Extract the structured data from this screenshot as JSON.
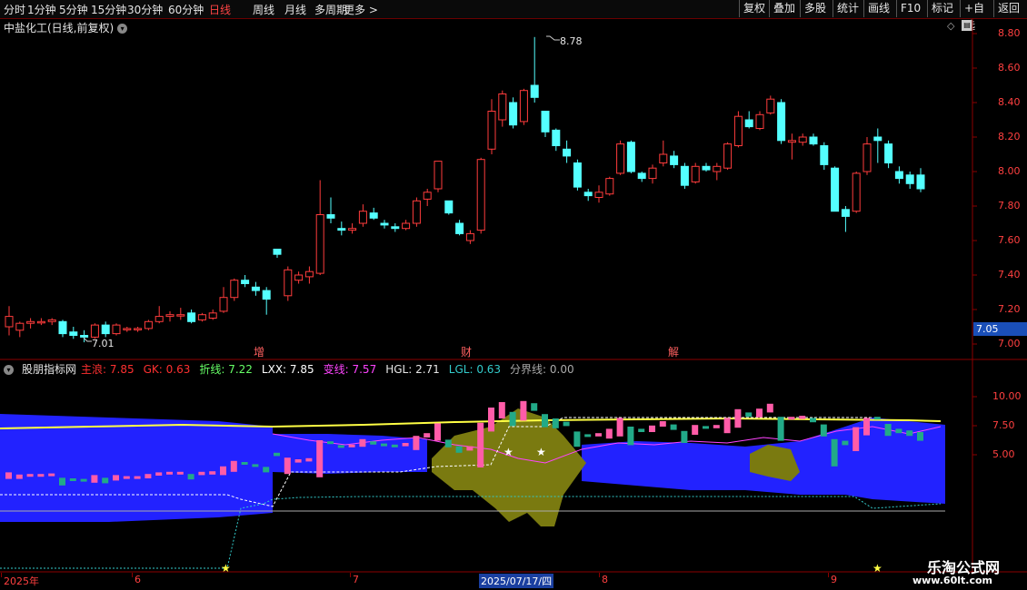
{
  "toolbar": {
    "periods": [
      "分时",
      "1分钟",
      "5分钟",
      "15分钟",
      "30分钟",
      "60分钟",
      "日线",
      "周线",
      "月线",
      "多周期",
      "更多 >"
    ],
    "active_period": "日线",
    "right_buttons": [
      "复权",
      "叠加",
      "多股",
      "统计",
      "画线",
      "F10",
      "标记",
      "+自选",
      "返回"
    ]
  },
  "main_chart": {
    "title": "中盐化工(日线,前复权)",
    "y_ticks": [
      "8.80",
      "8.60",
      "8.40",
      "8.20",
      "8.00",
      "7.80",
      "7.60",
      "7.40",
      "7.20",
      "7.00"
    ],
    "current_price": "7.05",
    "high_label": "8.78",
    "low_label": "7.01",
    "event_markers": [
      "增",
      "财",
      "解"
    ]
  },
  "indicator": {
    "name": "股朋指标网",
    "values": [
      {
        "label": "主浪",
        "value": "7.85",
        "color": "#ff3030"
      },
      {
        "label": "GK",
        "value": "0.63",
        "color": "#ff3030"
      },
      {
        "label": "折线",
        "value": "7.22",
        "color": "#66ff66"
      },
      {
        "label": "LXX",
        "value": "7.85",
        "color": "#ffffff"
      },
      {
        "label": "变线",
        "value": "7.57",
        "color": "#ff44ff"
      },
      {
        "label": "HGL",
        "value": "2.71",
        "color": "#e6e6e6"
      },
      {
        "label": "LGL",
        "value": "0.63",
        "color": "#33cccc"
      },
      {
        "label": "分界线",
        "value": "0.00",
        "color": "#aaaaaa"
      }
    ],
    "y_ticks": [
      "10.00",
      "7.50",
      "5.00"
    ]
  },
  "date_axis": {
    "labels": [
      "2025年",
      "6",
      "7",
      "2025/07/17/四",
      "8",
      "9"
    ]
  },
  "watermark": {
    "line1": "乐淘公式网",
    "line2": "www.60lt.com"
  },
  "chart_data": {
    "type": "candlestick",
    "title": "中盐化工(日线,前复权)",
    "ylim": [
      6.98,
      8.86
    ],
    "candles": [
      {
        "o": 7.1,
        "h": 7.22,
        "l": 7.05,
        "c": 7.16
      },
      {
        "o": 7.08,
        "h": 7.13,
        "l": 7.04,
        "c": 7.12
      },
      {
        "o": 7.12,
        "h": 7.15,
        "l": 7.09,
        "c": 7.13
      },
      {
        "o": 7.13,
        "h": 7.15,
        "l": 7.11,
        "c": 7.13
      },
      {
        "o": 7.13,
        "h": 7.15,
        "l": 7.11,
        "c": 7.14
      },
      {
        "o": 7.13,
        "h": 7.14,
        "l": 7.04,
        "c": 7.06
      },
      {
        "o": 7.07,
        "h": 7.1,
        "l": 7.03,
        "c": 7.05
      },
      {
        "o": 7.05,
        "h": 7.08,
        "l": 7.01,
        "c": 7.04
      },
      {
        "o": 7.04,
        "h": 7.12,
        "l": 7.03,
        "c": 7.11
      },
      {
        "o": 7.11,
        "h": 7.13,
        "l": 7.04,
        "c": 7.06
      },
      {
        "o": 7.06,
        "h": 7.12,
        "l": 7.05,
        "c": 7.11
      },
      {
        "o": 7.09,
        "h": 7.1,
        "l": 7.07,
        "c": 7.09
      },
      {
        "o": 7.09,
        "h": 7.1,
        "l": 7.07,
        "c": 7.09
      },
      {
        "o": 7.09,
        "h": 7.14,
        "l": 7.08,
        "c": 7.13
      },
      {
        "o": 7.13,
        "h": 7.22,
        "l": 7.12,
        "c": 7.16
      },
      {
        "o": 7.16,
        "h": 7.19,
        "l": 7.13,
        "c": 7.17
      },
      {
        "o": 7.17,
        "h": 7.21,
        "l": 7.14,
        "c": 7.17
      },
      {
        "o": 7.18,
        "h": 7.2,
        "l": 7.12,
        "c": 7.13
      },
      {
        "o": 7.14,
        "h": 7.18,
        "l": 7.13,
        "c": 7.17
      },
      {
        "o": 7.15,
        "h": 7.2,
        "l": 7.14,
        "c": 7.18
      },
      {
        "o": 7.19,
        "h": 7.33,
        "l": 7.18,
        "c": 7.27
      },
      {
        "o": 7.27,
        "h": 7.38,
        "l": 7.25,
        "c": 7.37
      },
      {
        "o": 7.37,
        "h": 7.4,
        "l": 7.33,
        "c": 7.35
      },
      {
        "o": 7.33,
        "h": 7.36,
        "l": 7.28,
        "c": 7.31
      },
      {
        "o": 7.31,
        "h": 7.33,
        "l": 7.17,
        "c": 7.26
      },
      {
        "o": 7.55,
        "h": 7.55,
        "l": 7.5,
        "c": 7.52
      },
      {
        "o": 7.28,
        "h": 7.45,
        "l": 7.25,
        "c": 7.43
      },
      {
        "o": 7.37,
        "h": 7.42,
        "l": 7.35,
        "c": 7.4
      },
      {
        "o": 7.39,
        "h": 7.45,
        "l": 7.35,
        "c": 7.42
      },
      {
        "o": 7.41,
        "h": 7.95,
        "l": 7.4,
        "c": 7.75
      },
      {
        "o": 7.75,
        "h": 7.85,
        "l": 7.7,
        "c": 7.73
      },
      {
        "o": 7.67,
        "h": 7.71,
        "l": 7.63,
        "c": 7.66
      },
      {
        "o": 7.66,
        "h": 7.7,
        "l": 7.64,
        "c": 7.67
      },
      {
        "o": 7.7,
        "h": 7.81,
        "l": 7.68,
        "c": 7.77
      },
      {
        "o": 7.76,
        "h": 7.79,
        "l": 7.72,
        "c": 7.73
      },
      {
        "o": 7.7,
        "h": 7.72,
        "l": 7.67,
        "c": 7.69
      },
      {
        "o": 7.68,
        "h": 7.7,
        "l": 7.65,
        "c": 7.67
      },
      {
        "o": 7.67,
        "h": 7.72,
        "l": 7.66,
        "c": 7.7
      },
      {
        "o": 7.7,
        "h": 7.85,
        "l": 7.68,
        "c": 7.83
      },
      {
        "o": 7.84,
        "h": 7.9,
        "l": 7.8,
        "c": 7.88
      },
      {
        "o": 7.9,
        "h": 8.05,
        "l": 7.88,
        "c": 8.06
      },
      {
        "o": 7.83,
        "h": 7.83,
        "l": 7.75,
        "c": 7.76
      },
      {
        "o": 7.7,
        "h": 7.72,
        "l": 7.63,
        "c": 7.64
      },
      {
        "o": 7.6,
        "h": 7.66,
        "l": 7.58,
        "c": 7.64
      },
      {
        "o": 7.66,
        "h": 8.08,
        "l": 7.64,
        "c": 8.07
      },
      {
        "o": 8.13,
        "h": 8.42,
        "l": 8.1,
        "c": 8.35
      },
      {
        "o": 8.3,
        "h": 8.47,
        "l": 8.26,
        "c": 8.45
      },
      {
        "o": 8.4,
        "h": 8.43,
        "l": 8.25,
        "c": 8.27
      },
      {
        "o": 8.29,
        "h": 8.48,
        "l": 8.27,
        "c": 8.47
      },
      {
        "o": 8.5,
        "h": 8.78,
        "l": 8.4,
        "c": 8.43
      },
      {
        "o": 8.35,
        "h": 8.35,
        "l": 8.2,
        "c": 8.23
      },
      {
        "o": 8.24,
        "h": 8.25,
        "l": 8.12,
        "c": 8.15
      },
      {
        "o": 8.13,
        "h": 8.18,
        "l": 8.05,
        "c": 8.09
      },
      {
        "o": 8.05,
        "h": 8.07,
        "l": 7.89,
        "c": 7.91
      },
      {
        "o": 7.88,
        "h": 7.9,
        "l": 7.83,
        "c": 7.86
      },
      {
        "o": 7.85,
        "h": 7.92,
        "l": 7.82,
        "c": 7.88
      },
      {
        "o": 7.87,
        "h": 7.97,
        "l": 7.86,
        "c": 7.96
      },
      {
        "o": 7.99,
        "h": 8.18,
        "l": 7.98,
        "c": 8.16
      },
      {
        "o": 8.17,
        "h": 8.18,
        "l": 7.99,
        "c": 8.0
      },
      {
        "o": 7.99,
        "h": 8.0,
        "l": 7.94,
        "c": 7.96
      },
      {
        "o": 7.96,
        "h": 8.04,
        "l": 7.93,
        "c": 8.02
      },
      {
        "o": 8.05,
        "h": 8.18,
        "l": 8.03,
        "c": 8.1
      },
      {
        "o": 8.09,
        "h": 8.12,
        "l": 8.02,
        "c": 8.04
      },
      {
        "o": 8.03,
        "h": 8.05,
        "l": 7.9,
        "c": 7.92
      },
      {
        "o": 7.94,
        "h": 8.05,
        "l": 7.93,
        "c": 8.03
      },
      {
        "o": 8.03,
        "h": 8.05,
        "l": 8.0,
        "c": 8.01
      },
      {
        "o": 8.0,
        "h": 8.05,
        "l": 7.95,
        "c": 8.03
      },
      {
        "o": 8.02,
        "h": 8.17,
        "l": 8.01,
        "c": 8.16
      },
      {
        "o": 8.15,
        "h": 8.35,
        "l": 8.14,
        "c": 8.32
      },
      {
        "o": 8.3,
        "h": 8.35,
        "l": 8.25,
        "c": 8.26
      },
      {
        "o": 8.25,
        "h": 8.35,
        "l": 8.24,
        "c": 8.33
      },
      {
        "o": 8.34,
        "h": 8.44,
        "l": 8.33,
        "c": 8.42
      },
      {
        "o": 8.4,
        "h": 8.42,
        "l": 8.16,
        "c": 8.18
      },
      {
        "o": 8.17,
        "h": 8.22,
        "l": 8.07,
        "c": 8.18
      },
      {
        "o": 8.17,
        "h": 8.22,
        "l": 8.15,
        "c": 8.2
      },
      {
        "o": 8.2,
        "h": 8.22,
        "l": 8.15,
        "c": 8.16
      },
      {
        "o": 8.15,
        "h": 8.17,
        "l": 8.01,
        "c": 8.04
      },
      {
        "o": 8.02,
        "h": 8.03,
        "l": 7.83,
        "c": 7.77
      },
      {
        "o": 7.78,
        "h": 7.8,
        "l": 7.65,
        "c": 7.74
      },
      {
        "o": 7.77,
        "h": 8.0,
        "l": 7.76,
        "c": 7.99
      },
      {
        "o": 8.0,
        "h": 8.2,
        "l": 7.98,
        "c": 8.16
      },
      {
        "o": 8.2,
        "h": 8.25,
        "l": 8.05,
        "c": 8.18
      },
      {
        "o": 8.16,
        "h": 8.18,
        "l": 8.02,
        "c": 8.05
      },
      {
        "o": 8.0,
        "h": 8.03,
        "l": 7.93,
        "c": 7.96
      },
      {
        "o": 7.98,
        "h": 8.0,
        "l": 7.9,
        "c": 7.93
      },
      {
        "o": 7.98,
        "h": 8.02,
        "l": 7.88,
        "c": 7.9
      }
    ]
  }
}
